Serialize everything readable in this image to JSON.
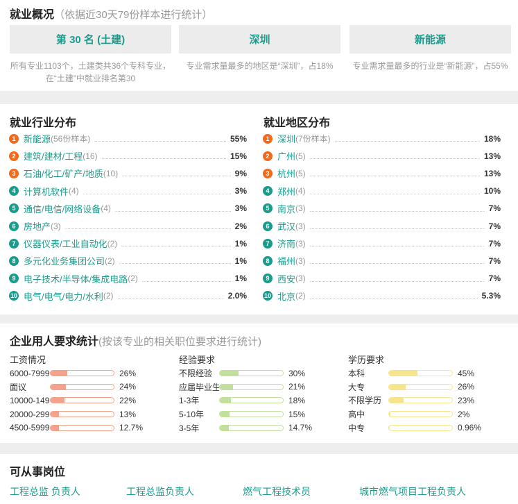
{
  "overview": {
    "title": "就业概况",
    "subtitle": "（依据近30天79份样本进行统计）",
    "cards": [
      {
        "label": "第 30 名 (土建)",
        "desc": "所有专业1103个，土建类共36个专科专业，在“土建”中就业排名第30"
      },
      {
        "label": "深圳",
        "desc": "专业需求量最多的地区是“深圳”，占18%"
      },
      {
        "label": "新能源",
        "desc": "专业需求量最多的行业是“新能源”，占55%"
      }
    ]
  },
  "industry": {
    "title": "就业行业分布",
    "items": [
      {
        "n": "1",
        "name": "新能源",
        "count": "(56份样本)",
        "pct": "55%"
      },
      {
        "n": "2",
        "name": "建筑/建材/工程",
        "count": "(16)",
        "pct": "15%"
      },
      {
        "n": "3",
        "name": "石油/化工/矿产/地质",
        "count": "(10)",
        "pct": "9%"
      },
      {
        "n": "4",
        "name": "计算机软件",
        "count": "(4)",
        "pct": "3%"
      },
      {
        "n": "5",
        "name": "通信/电信/网络设备",
        "count": "(4)",
        "pct": "3%"
      },
      {
        "n": "6",
        "name": "房地产",
        "count": "(3)",
        "pct": "2%"
      },
      {
        "n": "7",
        "name": "仪器仪表/工业自动化",
        "count": "(2)",
        "pct": "1%"
      },
      {
        "n": "8",
        "name": "多元化业务集团公司",
        "count": "(2)",
        "pct": "1%"
      },
      {
        "n": "9",
        "name": "电子技术/半导体/集成电路",
        "count": "(2)",
        "pct": "1%"
      },
      {
        "n": "10",
        "name": "电气/电气/电力/水利",
        "count": "(2)",
        "pct": "2.0%"
      }
    ]
  },
  "region": {
    "title": "就业地区分布",
    "items": [
      {
        "n": "1",
        "name": "深圳",
        "count": "(7份样本)",
        "pct": "18%"
      },
      {
        "n": "2",
        "name": "广州",
        "count": "(5)",
        "pct": "13%"
      },
      {
        "n": "3",
        "name": "杭州",
        "count": "(5)",
        "pct": "13%"
      },
      {
        "n": "4",
        "name": "郑州",
        "count": "(4)",
        "pct": "10%"
      },
      {
        "n": "5",
        "name": "南京",
        "count": "(3)",
        "pct": "7%"
      },
      {
        "n": "6",
        "name": "武汉",
        "count": "(3)",
        "pct": "7%"
      },
      {
        "n": "7",
        "name": "济南",
        "count": "(3)",
        "pct": "7%"
      },
      {
        "n": "8",
        "name": "福州",
        "count": "(3)",
        "pct": "7%"
      },
      {
        "n": "9",
        "name": "西安",
        "count": "(3)",
        "pct": "7%"
      },
      {
        "n": "10",
        "name": "北京",
        "count": "(2)",
        "pct": "5.3%"
      }
    ]
  },
  "requirements": {
    "title": "企业用人要求统计",
    "subtitle": "(按该专业的相关职位要求进行统计)",
    "groups": [
      {
        "head": "工资情况",
        "color": "#f3a28b",
        "border": "#f3a28b",
        "rows": [
          {
            "label": "6000-7999",
            "pct": "26%",
            "value": 0.26
          },
          {
            "label": "面议",
            "pct": "24%",
            "value": 0.24
          },
          {
            "label": "10000-149",
            "pct": "22%",
            "value": 0.22
          },
          {
            "label": "20000-299",
            "pct": "13%",
            "value": 0.13
          },
          {
            "label": "4500-5999",
            "pct": "12.7%",
            "value": 0.127
          }
        ]
      },
      {
        "head": "经验要求",
        "color": "#c2df9e",
        "border": "#c2df9e",
        "rows": [
          {
            "label": "不限经验",
            "pct": "30%",
            "value": 0.3
          },
          {
            "label": "应届毕业生",
            "pct": "21%",
            "value": 0.21
          },
          {
            "label": "1-3年",
            "pct": "18%",
            "value": 0.18
          },
          {
            "label": "5-10年",
            "pct": "15%",
            "value": 0.15
          },
          {
            "label": "3-5年",
            "pct": "14.7%",
            "value": 0.147
          }
        ]
      },
      {
        "head": "学历要求",
        "color": "#f6e58c",
        "border": "#f6e58c",
        "rows": [
          {
            "label": "本科",
            "pct": "45%",
            "value": 0.45
          },
          {
            "label": "大专",
            "pct": "26%",
            "value": 0.26
          },
          {
            "label": "不限学历",
            "pct": "23%",
            "value": 0.23
          },
          {
            "label": "高中",
            "pct": "2%",
            "value": 0.02
          },
          {
            "label": "中专",
            "pct": "0.96%",
            "value": 0.0096
          }
        ]
      }
    ]
  },
  "jobs": {
    "title": "可从事岗位",
    "items": [
      "工程总监 负责人",
      "工程总监负责人",
      "燃气工程技术员",
      "城市燃气项目工程负责人"
    ]
  },
  "colors": {
    "accent": "#1a9c8c",
    "orange": "#f26a1b"
  }
}
